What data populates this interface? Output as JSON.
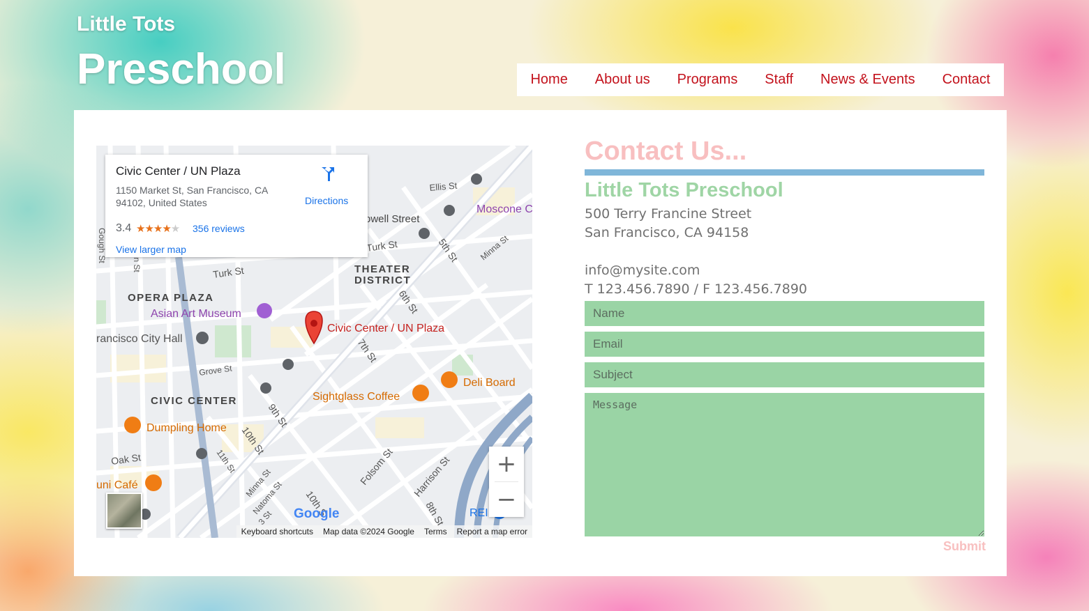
{
  "brand": {
    "line1": "Little Tots",
    "line2": "Preschool"
  },
  "nav": [
    "Home",
    "About us",
    "Programs",
    "Staff",
    "News & Events",
    "Contact"
  ],
  "map": {
    "card": {
      "place": "Civic Center / UN Plaza",
      "address": "1150 Market St, San Francisco, CA 94102, United States",
      "rating": "3.4",
      "reviews": "356 reviews",
      "larger": "View larger map",
      "directions": "Directions"
    },
    "labels": {
      "pin": "Civic Center / UN Plaza",
      "theater1": "THEATER",
      "theater2": "DISTRICT",
      "opera": "OPERA PLAZA",
      "civic": "CIVIC CENTER",
      "asian": "Asian Art Museum",
      "cityhall": "rancisco City Hall",
      "moscone": "Moscone C",
      "deli": "Deli Board",
      "sightglass": "Sightglass Coffee",
      "dumpling": "Dumpling Home",
      "zuni": "uni Café",
      "rei": "REI",
      "ellis": "Ellis St",
      "powell": "owell Street",
      "turk1": "Turk St",
      "turk2": "Turk St",
      "fifth": "5th St",
      "sixth": "6th St",
      "seventh": "7th St",
      "ninth": "9th St",
      "tenth": "10th St",
      "tenth2": "10th S",
      "eleventh": "11th St",
      "grove": "Grove St",
      "oak": "Oak St",
      "minna1": "Minna St",
      "minna2": "Minna St",
      "natoma": "Natoma St",
      "folsom": "Folsom St",
      "harrison": "Harrison St",
      "eighth": "8th St",
      "gough": "Gough St",
      "franklin": "lin St",
      "st3": "3 St"
    },
    "attribution": [
      "Keyboard shortcuts",
      "Map data ©2024 Google",
      "Terms",
      "Report a map error"
    ],
    "logo": "Google"
  },
  "contact": {
    "title": "Contact Us...",
    "school": "Little Tots Preschool",
    "street": "500 Terry Francine Street",
    "city": "San Francisco, CA 94158",
    "email": "info@mysite.com",
    "phone": "T 123.456.7890 / F 123.456.7890",
    "form": {
      "name": "Name",
      "email": "Email",
      "subject": "Subject",
      "message": "Message",
      "submit": "Submit"
    }
  },
  "colors": {
    "nav_text": "#c3121c",
    "title": "#f8bfc0",
    "school": "#9fd5a5",
    "rule": "#7fb6d9",
    "field": "#9ad4a5"
  }
}
